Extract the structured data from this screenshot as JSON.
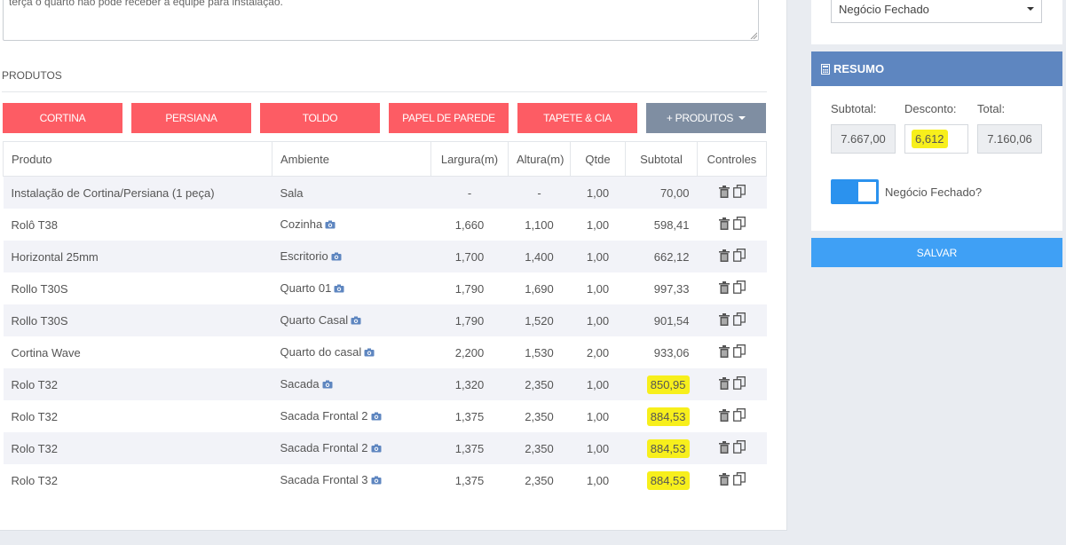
{
  "observacoes": {
    "text": "terça o quarto não pode receber a equipe para instalação."
  },
  "produtos_section": {
    "title": "PRODUTOS"
  },
  "buttons": {
    "cortina": "CORTINA",
    "persiana": "PERSIANA",
    "toldo": "TOLDO",
    "papel": "PAPEL DE PAREDE",
    "tapete": "TAPETE & CIA",
    "more": "+ PRODUTOS"
  },
  "table": {
    "headers": [
      "Produto",
      "Ambiente",
      "Largura(m)",
      "Altura(m)",
      "Qtde",
      "Subtotal",
      "Controles"
    ],
    "rows": [
      {
        "produto": "Instalação de Cortina/Persiana (1 peça)",
        "ambiente": "Sala",
        "largura": "-",
        "altura": "-",
        "qtde": "1,00",
        "subtotal": "70,00"
      },
      {
        "produto": "Rolô T38",
        "ambiente": "Cozinha",
        "largura": "1,660",
        "altura": "1,100",
        "qtde": "1,00",
        "subtotal": "598,41"
      },
      {
        "produto": "Horizontal 25mm",
        "ambiente": "Escritorio",
        "largura": "1,700",
        "altura": "1,400",
        "qtde": "1,00",
        "subtotal": "662,12"
      },
      {
        "produto": "Rollo T30S",
        "ambiente": "Quarto 01",
        "largura": "1,790",
        "altura": "1,690",
        "qtde": "1,00",
        "subtotal": "997,33"
      },
      {
        "produto": "Rollo T30S",
        "ambiente": "Quarto Casal",
        "largura": "1,790",
        "altura": "1,520",
        "qtde": "1,00",
        "subtotal": "901,54"
      },
      {
        "produto": "Cortina Wave",
        "ambiente": "Quarto do casal",
        "largura": "2,200",
        "altura": "1,530",
        "qtde": "2,00",
        "subtotal": "933,06"
      },
      {
        "produto": "Rolo T32",
        "ambiente": "Sacada",
        "largura": "1,320",
        "altura": "2,350",
        "qtde": "1,00",
        "subtotal": "850,95"
      },
      {
        "produto": "Rolo T32",
        "ambiente": "Sacada Frontal 2",
        "largura": "1,375",
        "altura": "2,350",
        "qtde": "1,00",
        "subtotal": "884,53"
      },
      {
        "produto": "Rolo T32",
        "ambiente": "Sacada Frontal 2",
        "largura": "1,375",
        "altura": "2,350",
        "qtde": "1,00",
        "subtotal": "884,53"
      },
      {
        "produto": "Rolo T32",
        "ambiente": "Sacada Frontal 3",
        "largura": "1,375",
        "altura": "2,350",
        "qtde": "1,00",
        "subtotal": "884,53"
      }
    ]
  },
  "status_select": {
    "value": "Negócio Fechado"
  },
  "resumo": {
    "title": "RESUMO",
    "subtotal_label": "Subtotal:",
    "desconto_label": "Desconto:",
    "total_label": "Total:",
    "subtotal": "7.667,00",
    "desconto": "6,612",
    "total": "7.160,06"
  },
  "negocio_toggle": {
    "label": "Negócio Fechado?"
  },
  "save_label": "SALVAR",
  "colors": {
    "product_button": "#fd5c64",
    "more_button": "#7f8ea2",
    "resumo_header": "#5e86c0",
    "toggle": "#2b92ee",
    "save_button": "#3fa0f5",
    "highlight": "#f7ef1c"
  }
}
